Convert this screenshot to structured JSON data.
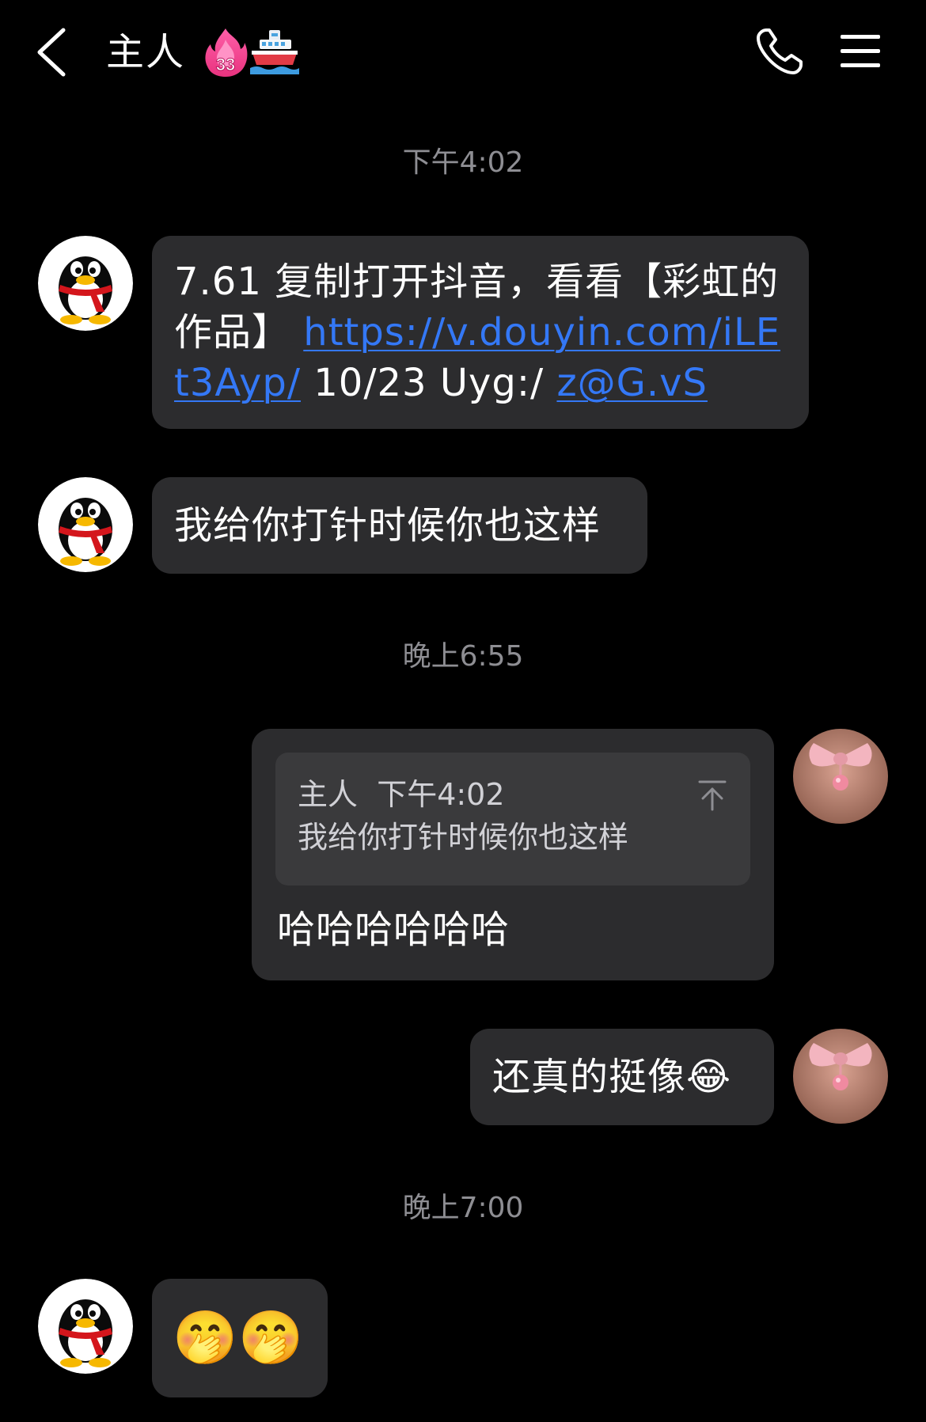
{
  "header": {
    "title": "主人",
    "badge_number": "33",
    "icons": [
      "back-icon",
      "fire-badge-icon",
      "ship-badge-icon",
      "phone-icon",
      "menu-icon"
    ]
  },
  "messages": {
    "ts1": "下午4:02",
    "m1": {
      "text_a": "7.61 复制打开抖音，看看【彩虹的作品】 ",
      "link1": "https://v.douyin.com/iLEt3Ayp/",
      "text_b": " 10/23 Uyg:/ ",
      "link2": "z@G.vS"
    },
    "m2": "我给你打针时候你也这样",
    "ts2": "晚上6:55",
    "m3": {
      "quote_sender": "主人",
      "quote_time": "下午4:02",
      "quote_text": "我给你打针时候你也这样",
      "reply": "哈哈哈哈哈哈"
    },
    "m4": {
      "text": "还真的挺像",
      "emoji": "😂"
    },
    "ts3": "晚上7:00",
    "m5": {
      "emoji1": "🤭",
      "emoji2": "🤭"
    }
  },
  "colors": {
    "background": "#000000",
    "bubble": "#2c2c2e",
    "quote_box": "#3a3a3c",
    "link": "#3478f6",
    "timestamp": "#8e8e93"
  }
}
